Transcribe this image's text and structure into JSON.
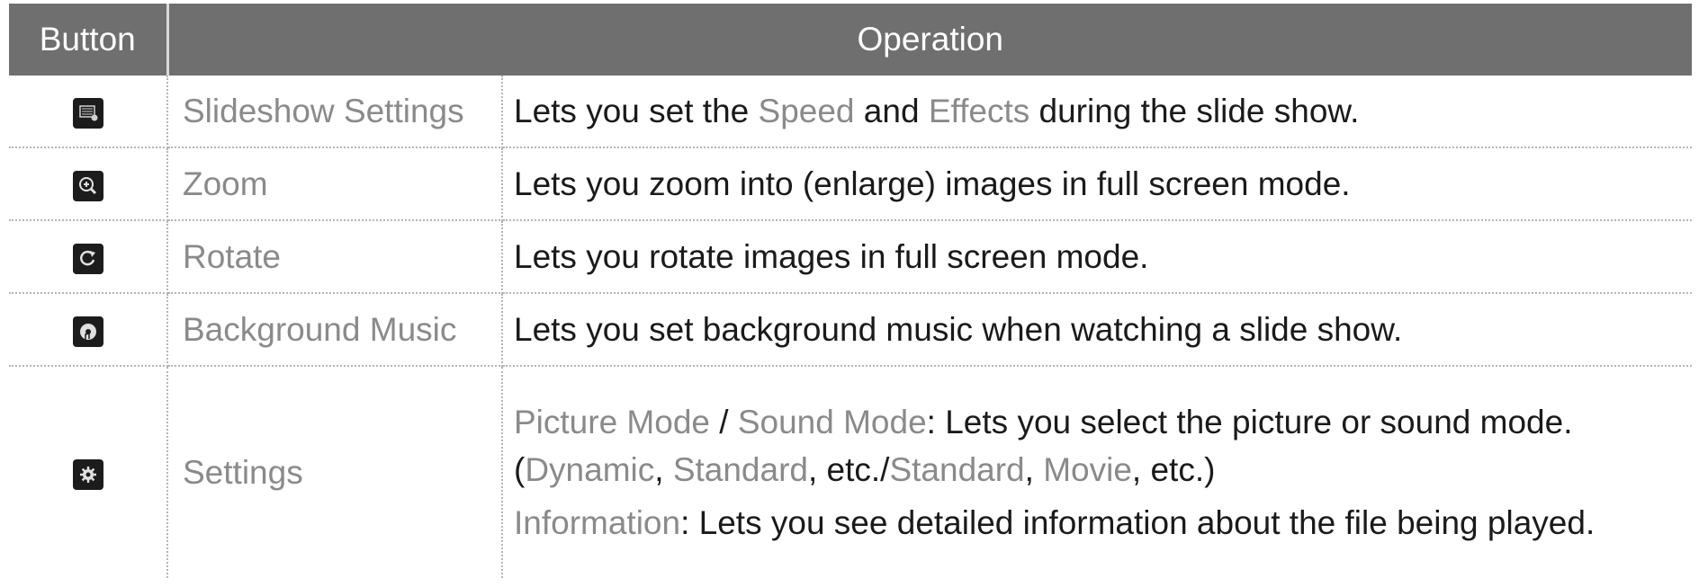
{
  "header": {
    "button": "Button",
    "operation": "Operation"
  },
  "rows": [
    {
      "icon": "slideshow-settings-icon",
      "name": "Slideshow Settings",
      "op": [
        [
          {
            "t": "Lets you set the "
          },
          {
            "t": "Speed",
            "h": 1
          },
          {
            "t": " and "
          },
          {
            "t": "Effects",
            "h": 1
          },
          {
            "t": " during the slide show."
          }
        ]
      ]
    },
    {
      "icon": "zoom-icon",
      "name": "Zoom",
      "op": [
        [
          {
            "t": "Lets you zoom into (enlarge) images in full screen mode."
          }
        ]
      ]
    },
    {
      "icon": "rotate-icon",
      "name": "Rotate",
      "op": [
        [
          {
            "t": "Lets you rotate images in full screen mode."
          }
        ]
      ]
    },
    {
      "icon": "background-music-icon",
      "name": "Background Music",
      "op": [
        [
          {
            "t": "Lets you set background music when watching a slide show."
          }
        ]
      ]
    },
    {
      "icon": "settings-gear-icon",
      "name": "Settings",
      "op": [
        [
          {
            "t": "Picture Mode",
            "h": 1
          },
          {
            "t": " / "
          },
          {
            "t": "Sound Mode",
            "h": 1
          },
          {
            "t": ": Lets you select the picture or sound mode. ("
          },
          {
            "t": "Dynamic",
            "h": 1
          },
          {
            "t": ", "
          },
          {
            "t": "Standard",
            "h": 1
          },
          {
            "t": ", etc./"
          },
          {
            "t": "Standard",
            "h": 1
          },
          {
            "t": ", "
          },
          {
            "t": "Movie",
            "h": 1
          },
          {
            "t": ", etc.)"
          }
        ],
        [
          {
            "t": "Information",
            "h": 1
          },
          {
            "t": ": Lets you see detailed information about the file being played."
          }
        ]
      ]
    }
  ]
}
